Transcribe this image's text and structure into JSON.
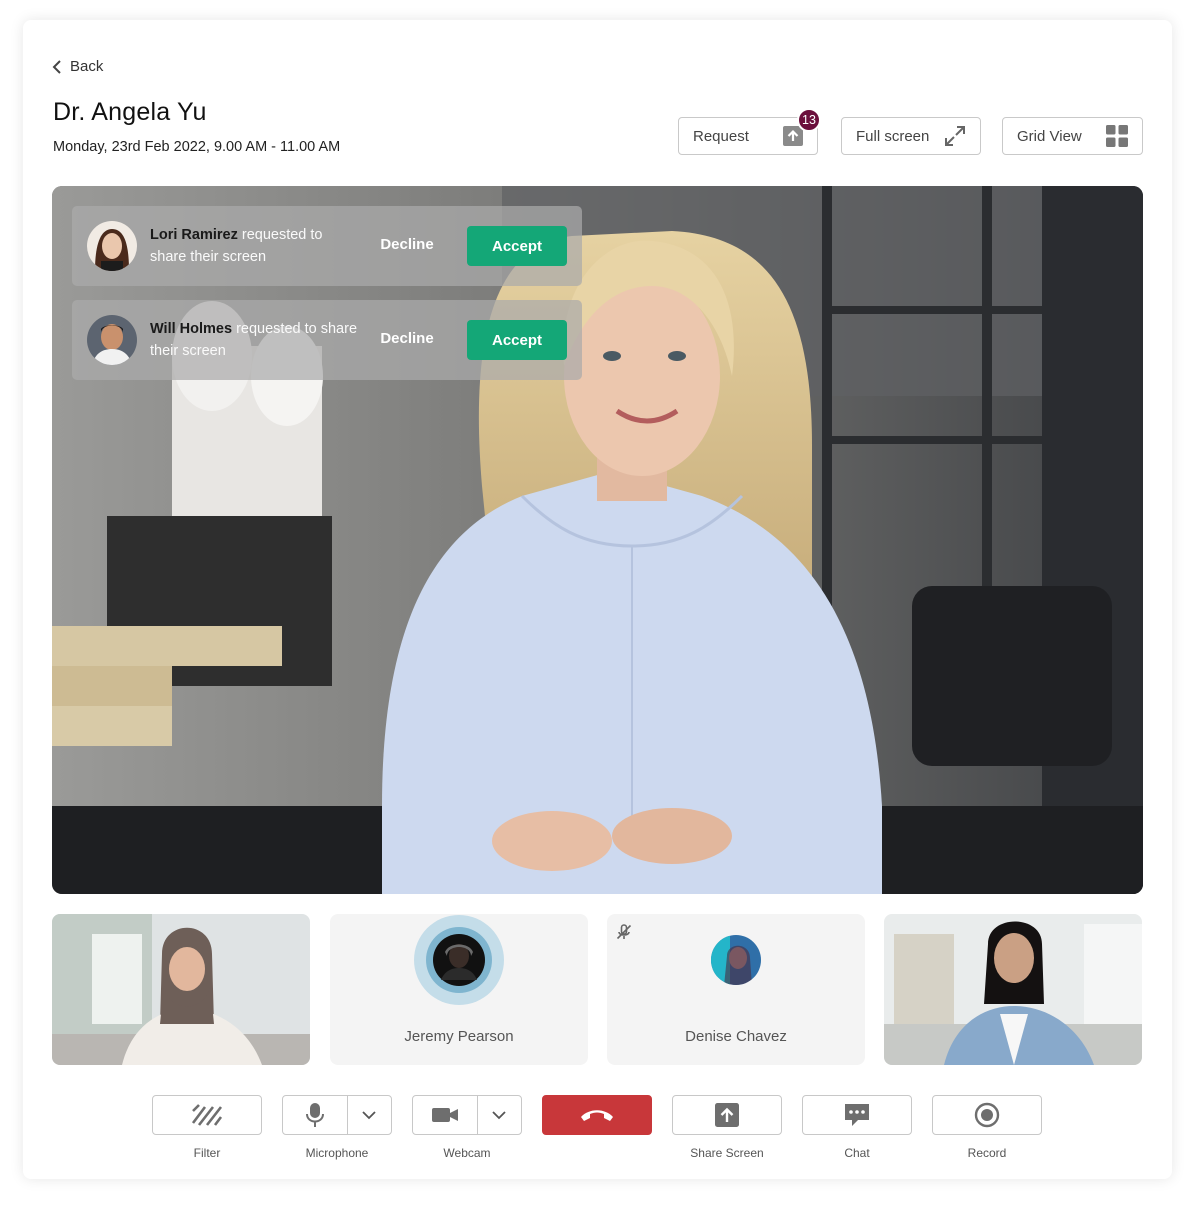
{
  "nav": {
    "back_label": "Back"
  },
  "header": {
    "title": "Dr. Angela Yu",
    "subtitle": "Monday, 23rd Feb 2022, 9.00 AM - 11.00 AM"
  },
  "toolbar": {
    "request_label": "Request",
    "request_count": "13",
    "fullscreen_label": "Full screen",
    "gridview_label": "Grid View"
  },
  "requests": [
    {
      "name": "Lori Ramirez",
      "message": "requested to share their screen",
      "decline": "Decline",
      "accept": "Accept"
    },
    {
      "name": "Will Holmes",
      "message": "requested to share their screen",
      "decline": "Decline",
      "accept": "Accept"
    }
  ],
  "participants": [
    {
      "name": "",
      "state": "video"
    },
    {
      "name": "Jeremy Pearson",
      "state": "speaking"
    },
    {
      "name": "Denise Chavez",
      "state": "muted"
    },
    {
      "name": "",
      "state": "video"
    }
  ],
  "controls": {
    "filter": "Filter",
    "microphone": "Microphone",
    "webcam": "Webcam",
    "share_screen": "Share Screen",
    "chat": "Chat",
    "record": "Record"
  },
  "colors": {
    "accept": "#14a777",
    "end_call": "#c8373a",
    "badge": "#6b0f3c"
  }
}
